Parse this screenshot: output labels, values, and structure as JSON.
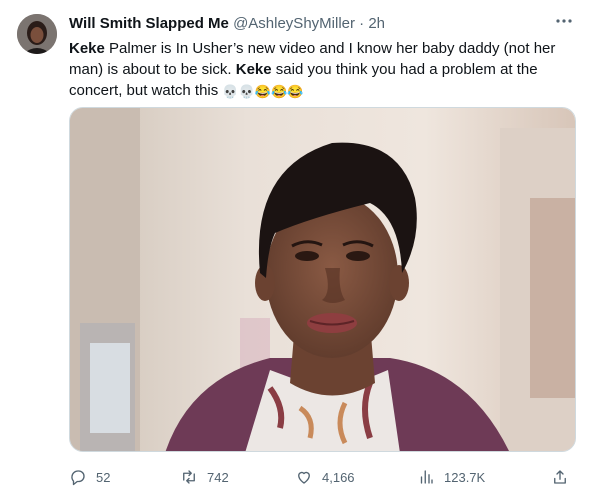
{
  "tweet": {
    "display_name": "Will Smith Slapped Me",
    "handle": "@AshleyShyMiller",
    "separator": "·",
    "time": "2h",
    "text": {
      "bold_1": "Keke",
      "part_1": " Palmer is In Usher’s new video and I know her baby daddy (not her man) is about to be sick. ",
      "bold_2": "Keke",
      "part_2": " said you think you had a problem at the concert, but watch this ",
      "emojis": "💀💀😂😂😂"
    }
  },
  "actions": {
    "replies": "52",
    "retweets": "742",
    "likes": "4,166",
    "views": "123.7K"
  },
  "icons": [
    "more-icon",
    "reply-icon",
    "retweet-icon",
    "like-icon",
    "views-icon",
    "share-icon"
  ],
  "colors": {
    "text": "#0f1419",
    "secondary": "#536471",
    "border": "#cfd9de",
    "cardigan": "#6e3a56"
  }
}
